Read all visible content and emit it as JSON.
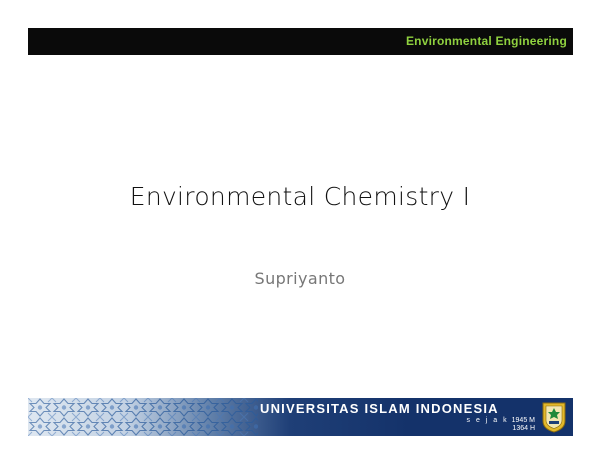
{
  "header": {
    "text": "Environmental Engineering"
  },
  "slide": {
    "title": "Environmental Chemistry I",
    "author": "Supriyanto"
  },
  "footer": {
    "university": "UNIVERSITAS ISLAM INDONESIA",
    "since_word": "s e j a k",
    "year_m": "1945 M",
    "year_h": "1364 H"
  },
  "colors": {
    "header_bg": "#0a0a0a",
    "header_text": "#8fd13f",
    "banner_blue": "#14326a",
    "emblem_gold": "#e2b82a"
  },
  "icons": {
    "banner_pattern": "islamic-geometric-pattern",
    "emblem": "university-crest-icon"
  }
}
